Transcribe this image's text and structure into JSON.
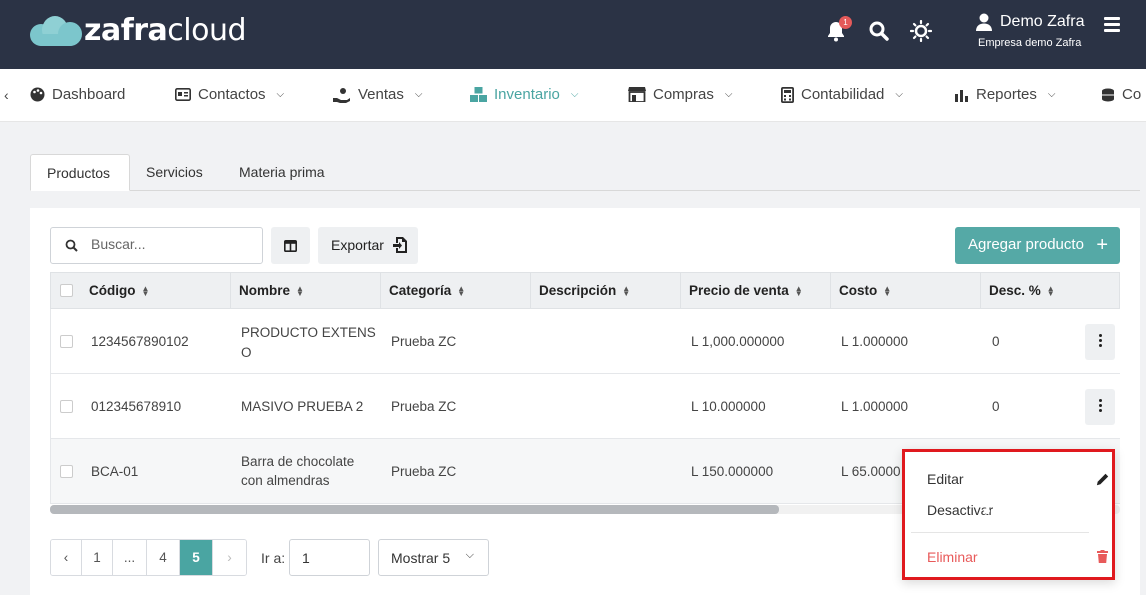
{
  "brand": {
    "name_bold": "zafra",
    "name_light": "cloud"
  },
  "header": {
    "notifications_count": "1",
    "user_name": "Demo Zafra",
    "company": "Empresa demo Zafra"
  },
  "menu": {
    "items": [
      {
        "label": "Dashboard",
        "icon": "palette-icon",
        "has_dropdown": false
      },
      {
        "label": "Contactos",
        "icon": "contact-card-icon",
        "has_dropdown": true
      },
      {
        "label": "Ventas",
        "icon": "hand-sale-icon",
        "has_dropdown": true
      },
      {
        "label": "Inventario",
        "icon": "boxes-icon",
        "has_dropdown": true,
        "active": true
      },
      {
        "label": "Compras",
        "icon": "store-icon",
        "has_dropdown": true
      },
      {
        "label": "Contabilidad",
        "icon": "calculator-icon",
        "has_dropdown": true
      },
      {
        "label": "Reportes",
        "icon": "bar-chart-icon",
        "has_dropdown": true
      },
      {
        "label": "Co",
        "icon": "database-icon",
        "has_dropdown": false
      }
    ],
    "active_color": "#4aa5a2"
  },
  "tabs": [
    {
      "label": "Productos",
      "active": true
    },
    {
      "label": "Servicios",
      "active": false
    },
    {
      "label": "Materia prima",
      "active": false
    }
  ],
  "toolbar": {
    "search_placeholder": "Buscar...",
    "export_label": "Exportar",
    "add_label": "Agregar producto"
  },
  "table": {
    "columns": [
      "Código",
      "Nombre",
      "Categoría",
      "Descripción",
      "Precio de venta",
      "Costo",
      "Desc. %"
    ],
    "rows": [
      {
        "code": "1234567890102",
        "name_line1": "PRODUCTO EXTENS",
        "name_line2": "O",
        "category": "Prueba ZC",
        "description": "",
        "price": "L 1,000.000000",
        "cost": "L 1.000000",
        "discount": "0"
      },
      {
        "code": "012345678910",
        "name_line1": "MASIVO PRUEBA 2",
        "name_line2": "",
        "category": "Prueba ZC",
        "description": "",
        "price": "L 10.000000",
        "cost": "L 1.000000",
        "discount": "0"
      },
      {
        "code": "BCA-01",
        "name_line1": "Barra de chocolate",
        "name_line2": "con almendras",
        "category": "Prueba ZC",
        "description": "",
        "price": "L 150.000000",
        "cost": "L 65.0000",
        "discount": ""
      }
    ]
  },
  "pagination": {
    "pages": [
      "1",
      "...",
      "4",
      "5"
    ],
    "current": "5",
    "goto_label": "Ir a:",
    "goto_value": "1",
    "show_label": "Mostrar 5"
  },
  "row_menu": {
    "edit_label": "Editar",
    "deactivate_label": "Desactivar",
    "delete_label": "Eliminar",
    "danger_color": "#e85a5a",
    "toggle_color": "#3cb38a"
  }
}
